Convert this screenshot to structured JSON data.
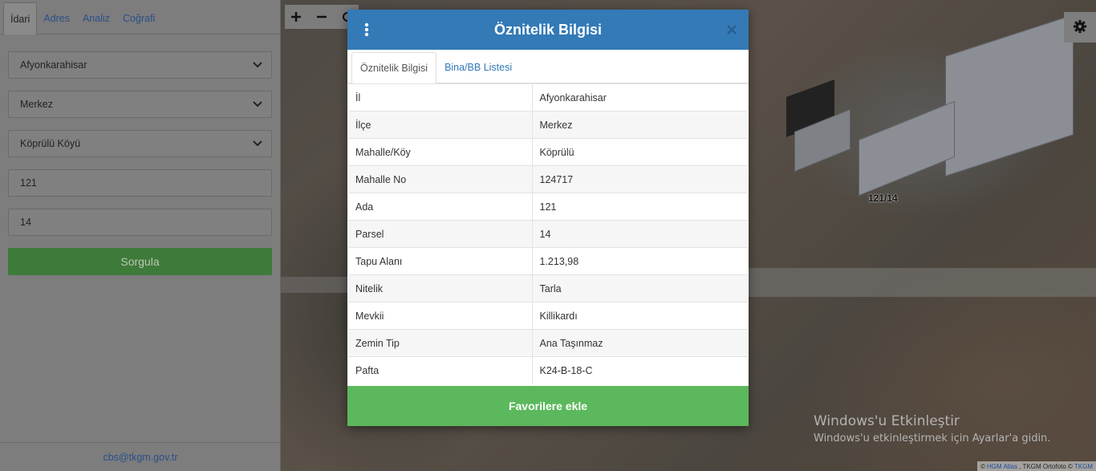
{
  "sidebar": {
    "tabs": [
      {
        "label": "İdari",
        "active": true
      },
      {
        "label": "Adres",
        "active": false
      },
      {
        "label": "Analiz",
        "active": false
      },
      {
        "label": "Coğrafi",
        "active": false
      }
    ],
    "province": "Afyonkarahisar",
    "district": "Merkez",
    "neighborhood": "Köprülü Köyü",
    "block": "121",
    "parcel": "14",
    "submit_label": "Sorgula",
    "footer_email": "cbs@tkgm.gov.tr"
  },
  "map": {
    "parcel_label": "121/14",
    "attribution": {
      "prefix": "©",
      "hgm": "HGM Atlas",
      "middle": ", TKGM Ortofoto ©",
      "tkgm": "TKGM"
    },
    "watermark": {
      "line1": "Windows'u Etkinleştir",
      "line2": "Windows'u etkinleştirmek için Ayarlar'a gidin."
    }
  },
  "modal": {
    "title": "Öznitelik Bilgisi",
    "tabs": [
      {
        "label": "Öznitelik Bilgisi",
        "active": true
      },
      {
        "label": "Bina/BB Listesi",
        "active": false
      }
    ],
    "rows": [
      {
        "key": "İl",
        "value": "Afyonkarahisar"
      },
      {
        "key": "İlçe",
        "value": "Merkez"
      },
      {
        "key": "Mahalle/Köy",
        "value": "Köprülü"
      },
      {
        "key": "Mahalle No",
        "value": "124717"
      },
      {
        "key": "Ada",
        "value": "121"
      },
      {
        "key": "Parsel",
        "value": "14"
      },
      {
        "key": "Tapu Alanı",
        "value": "1.213,98"
      },
      {
        "key": "Nitelik",
        "value": "Tarla"
      },
      {
        "key": "Mevkii",
        "value": "Killikardı"
      },
      {
        "key": "Zemin Tip",
        "value": "Ana Taşınmaz"
      },
      {
        "key": "Pafta",
        "value": "K24-B-18-C"
      }
    ],
    "favorite_label": "Favorilere ekle"
  },
  "colors": {
    "header": "#337ab7",
    "favorite": "#5cb85c",
    "sorgula": "#3e7a3a"
  }
}
